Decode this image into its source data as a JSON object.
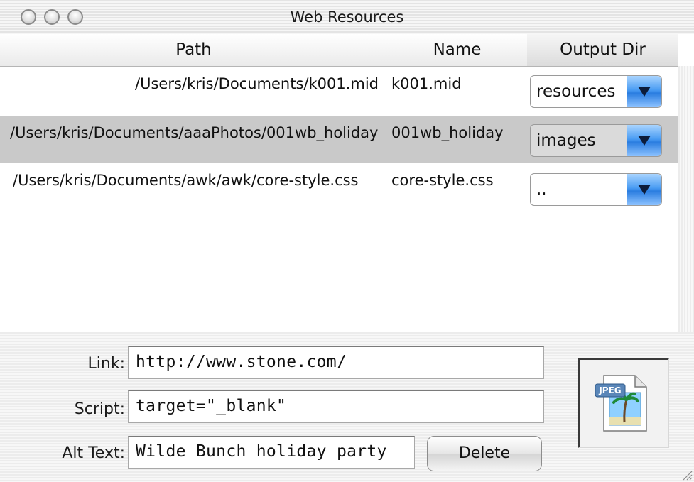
{
  "window": {
    "title": "Web Resources"
  },
  "table": {
    "columns": [
      "Path",
      "Name",
      "Output Dir"
    ],
    "rows": [
      {
        "path": "/Users/kris/Documents/k001.mid",
        "name": "k001.mid",
        "output_dir": "resources",
        "selected": false
      },
      {
        "path": "/Users/kris/Documents/aaaPhotos/001wb_holiday",
        "name": "001wb_holiday",
        "output_dir": "images",
        "selected": true
      },
      {
        "path": "/Users/kris/Documents/awk/awk/core-style.css",
        "name": "core-style.css",
        "output_dir": "..",
        "selected": false
      }
    ]
  },
  "form": {
    "link_label": "Link:",
    "link_value": "http://www.stone.com/",
    "script_label": "Script:",
    "script_value": "target=\"_blank\"",
    "alt_label": "Alt Text:",
    "alt_value": "Wilde Bunch holiday  party",
    "delete_label": "Delete"
  },
  "preview": {
    "badge": "JPEG",
    "icon": "jpeg-file-icon"
  },
  "colors": {
    "selection": "#c9c9c9",
    "popup_arrow": "#3f8ff0"
  }
}
